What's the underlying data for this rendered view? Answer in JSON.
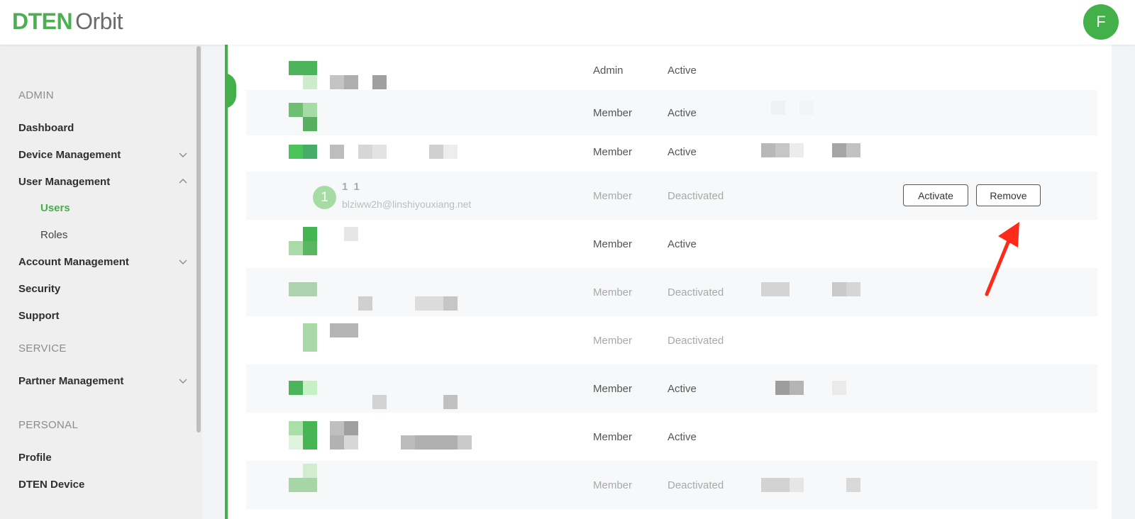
{
  "header": {
    "logo_brand": "DTEN",
    "logo_product": "Orbit",
    "avatar_initial": "F",
    "brand_color": "#43b049"
  },
  "sidebar": {
    "section_admin": "ADMIN",
    "dashboard": "Dashboard",
    "device_management": "Device Management",
    "user_management": "User Management",
    "users": "Users",
    "roles": "Roles",
    "account_management": "Account Management",
    "security": "Security",
    "support": "Support",
    "section_service": "SERVICE",
    "partner_management": "Partner Management",
    "section_personal": "PERSONAL",
    "profile": "Profile",
    "dten_device": "DTEN Device"
  },
  "users": [
    {
      "role": "Admin",
      "status": "Active"
    },
    {
      "role": "Member",
      "status": "Active"
    },
    {
      "role": "Member",
      "status": "Active"
    },
    {
      "avatar": "1",
      "name": "1 1",
      "email": "blziww2h@linshiyouxiang.net",
      "role": "Member",
      "status": "Deactivated",
      "activate_label": "Activate",
      "remove_label": "Remove"
    },
    {
      "role": "Member",
      "status": "Active"
    },
    {
      "role": "Member",
      "status": "Deactivated"
    },
    {
      "role": "Member",
      "status": "Deactivated"
    },
    {
      "role": "Member",
      "status": "Active"
    },
    {
      "role": "Member",
      "status": "Active"
    },
    {
      "role": "Member",
      "status": "Deactivated"
    }
  ]
}
